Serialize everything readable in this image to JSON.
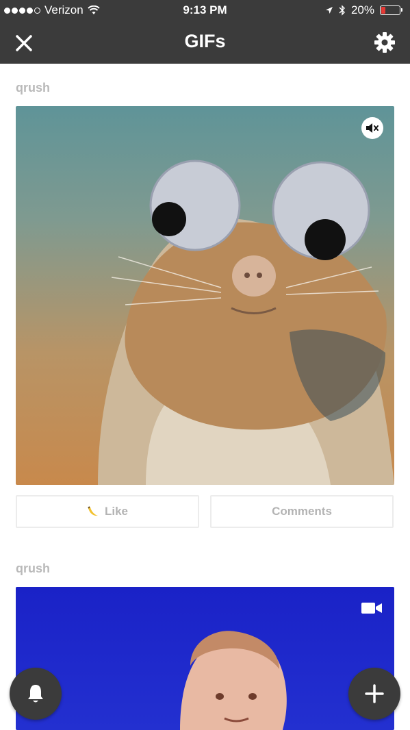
{
  "status_bar": {
    "carrier": "Verizon",
    "time": "9:13 PM",
    "battery_percent": "20%",
    "battery_level": 0.2,
    "battery_color": "#e53935"
  },
  "nav": {
    "title": "GIFs",
    "left_icon": "close-icon",
    "right_icon": "gear-icon"
  },
  "posts": [
    {
      "username": "qrush",
      "media_type": "gif",
      "badge_icon": "mute-icon",
      "like_label": "Like",
      "like_icon": "banana-icon",
      "comments_label": "Comments"
    },
    {
      "username": "qrush",
      "media_type": "video",
      "badge_icon": "video-camera-icon"
    }
  ],
  "floating_buttons": [
    {
      "icon": "bell-icon"
    },
    {
      "icon": "plus-icon"
    }
  ],
  "colors": {
    "bar_background": "#3b3b3b",
    "username_text": "#b9b9b9",
    "button_text": "#b3b3b3"
  }
}
